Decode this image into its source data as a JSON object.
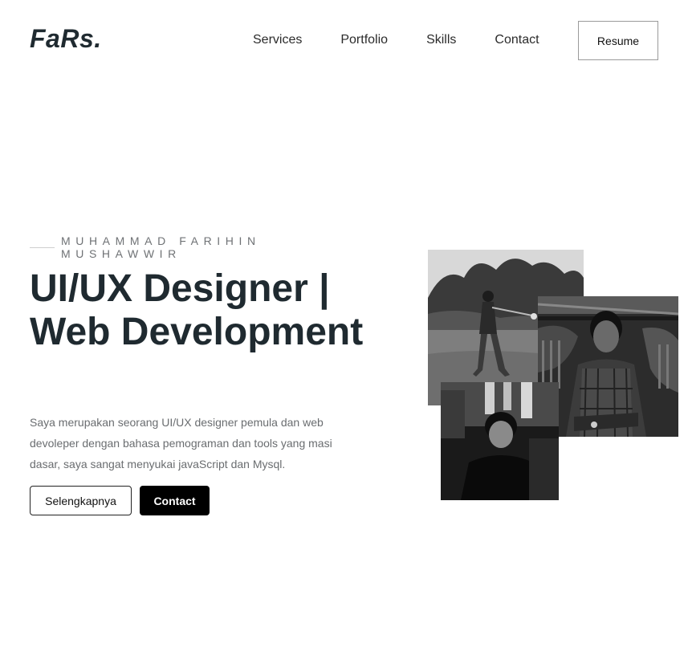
{
  "brand": {
    "logo": "FaRs."
  },
  "nav": {
    "items": [
      "Services",
      "Portfolio",
      "Skills",
      "Contact"
    ],
    "resume_label": "Resume"
  },
  "hero": {
    "eyebrow": "MUHAMMAD FARIHIN MUSHAWWIR",
    "headline": "UI/UX Designer | Web Development",
    "description": "Saya merupakan seorang UI/UX designer pemula dan web devoleper dengan bahasa pemograman dan tools yang masi dasar, saya sangat menyukai javaScript dan Mysql.",
    "primary_label": "Selengkapnya",
    "secondary_label": "Contact"
  },
  "photos": [
    {
      "name": "golf-photo",
      "tone": "grayscale"
    },
    {
      "name": "portrait-photo",
      "tone": "grayscale"
    },
    {
      "name": "seated-photo",
      "tone": "grayscale"
    }
  ]
}
